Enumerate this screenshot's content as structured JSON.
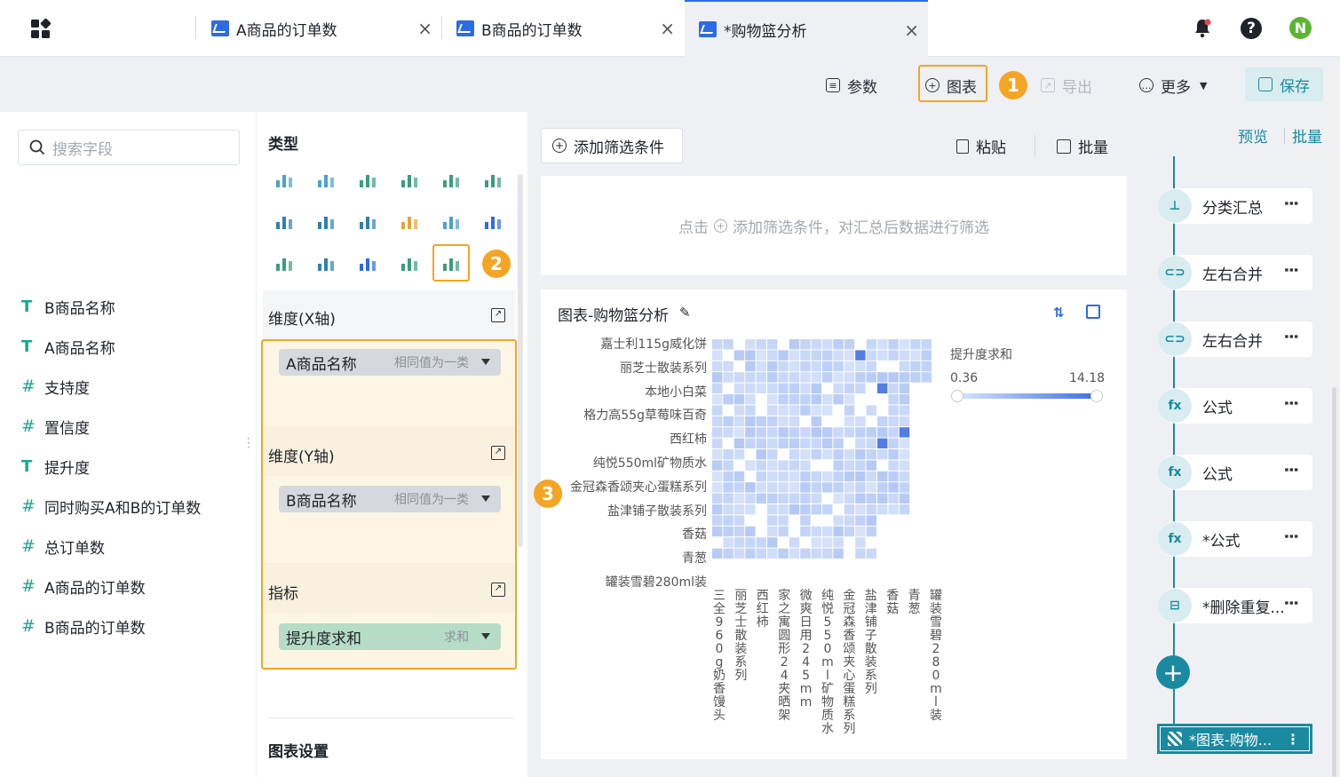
{
  "tabs": [
    {
      "label": "A商品的订单数"
    },
    {
      "label": "B商品的订单数"
    },
    {
      "label": "*购物篮分析"
    }
  ],
  "user_initial": "N",
  "toolbar": {
    "params_label": "参数",
    "chart_label": "图表",
    "export_label": "导出",
    "more_label": "更多",
    "save_label": "保存"
  },
  "badges": [
    "1",
    "2",
    "3"
  ],
  "search": {
    "placeholder": "搜索字段"
  },
  "fields": [
    {
      "type": "text",
      "label": "B商品名称"
    },
    {
      "type": "text",
      "label": "A商品名称"
    },
    {
      "type": "number",
      "label": "支持度"
    },
    {
      "type": "number",
      "label": "置信度"
    },
    {
      "type": "text",
      "label": "提升度"
    },
    {
      "type": "number",
      "label": "同时购买A和B的订单数"
    },
    {
      "type": "number",
      "label": "总订单数"
    },
    {
      "type": "number",
      "label": "A商品的订单数"
    },
    {
      "type": "number",
      "label": "B商品的订单数"
    }
  ],
  "config": {
    "type_title": "类型",
    "x_axis_title": "维度(X轴)",
    "x_chip": {
      "label": "A商品名称",
      "hint": "相同值为一类"
    },
    "y_axis_title": "维度(Y轴)",
    "y_chip": {
      "label": "B商品名称",
      "hint": "相同值为一类"
    },
    "metric_title": "指标",
    "metric_chip": {
      "label": "提升度求和",
      "hint": "求和"
    },
    "chart_settings_title": "图表设置"
  },
  "filter": {
    "add_label": "添加筛选条件",
    "paste_label": "粘贴",
    "batch_label": "批量",
    "empty_hint_pre": "点击",
    "empty_hint_post": "添加筛选条件，对汇总后数据进行筛选"
  },
  "chart_panel": {
    "title": "图表-购物篮分析",
    "legend_title": "提升度求和",
    "legend_min": "0.36",
    "legend_max": "14.18"
  },
  "chart_data": {
    "type": "heatmap",
    "y_ticks": [
      "嘉士利115g威化饼",
      "丽芝士散装系列",
      "本地小白菜",
      "格力高55g草莓味百奇",
      "西红柿",
      "纯悦550ml矿物质水",
      "金冠森香颂夹心蛋糕系列",
      "盐津铺子散装系列",
      "香菇",
      "青葱",
      "罐装雪碧280ml装"
    ],
    "x_ticks": [
      "三全960g奶香馒头",
      "丽芝士散装系列",
      "西红柿",
      "家之寓圆形24夹晒架",
      "微爽日用245mm",
      "纯悦550ml矿物质水",
      "金冠森香颂夹心蛋糕系列",
      "盐津铺子散装系列",
      "香菇",
      "青葱",
      "罐装雪碧280ml装"
    ],
    "color_range": [
      0.36,
      14.18
    ],
    "colors": {
      "low": "#dbe6fb",
      "high": "#3a6be0"
    }
  },
  "pipeline": {
    "preview_label": "预览",
    "batch_label": "批量",
    "steps": [
      {
        "icon": "tree",
        "label": "分类汇总"
      },
      {
        "icon": "merge",
        "label": "左右合并"
      },
      {
        "icon": "merge",
        "label": "左右合并"
      },
      {
        "icon": "fx",
        "label": "公式"
      },
      {
        "icon": "fx",
        "label": "公式"
      },
      {
        "icon": "fx",
        "label": "*公式"
      },
      {
        "icon": "dedup",
        "label": "*删除重复..."
      }
    ],
    "final_step": "*图表-购物..."
  }
}
